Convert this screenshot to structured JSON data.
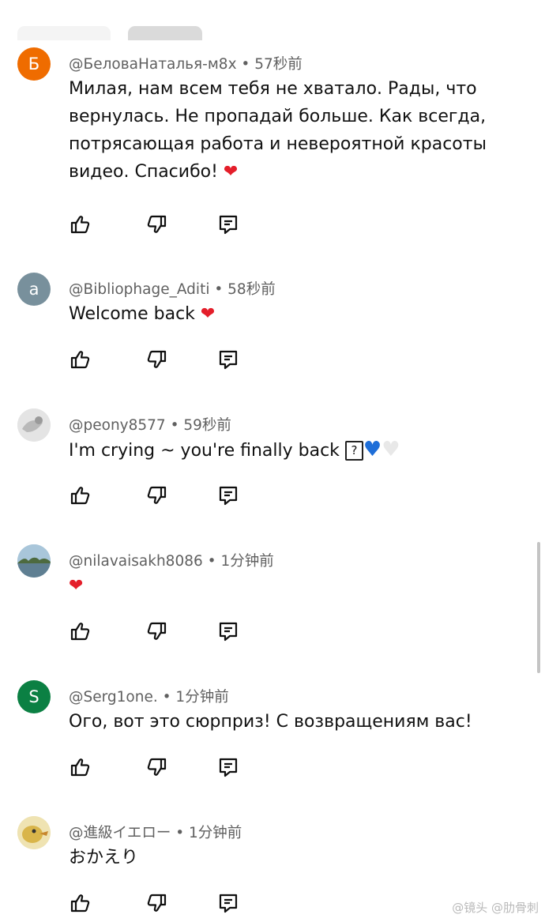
{
  "comments": [
    {
      "avatar_letter": "Б",
      "avatar_color": "#ef6c00",
      "author": "@БеловаНаталья-м8х",
      "separator": " • ",
      "time": "57秒前",
      "text": "Милая, нам всем тебя не хватало. Рады, что вернулась. Не пропадай больше. Как всегда, потрясающая работа и невероятной красоты видео. Спасибо! ",
      "emoji": "❤"
    },
    {
      "avatar_letter": "a",
      "avatar_color": "#78909c",
      "author": "@Bibliophage_Aditi",
      "separator": " • ",
      "time": "58秒前",
      "text": "Welcome back ",
      "emoji": "❤"
    },
    {
      "avatar_letter": "",
      "avatar_color": "#dcdcdc",
      "author": "@peony8577",
      "separator": " • ",
      "time": "59秒前",
      "text": "I'm crying ~ you're finally back ",
      "box_glyph": "?",
      "emoji_blue": "♥",
      "emoji_white": "♥"
    },
    {
      "avatar_letter": "",
      "avatar_color": "#8fb3c9",
      "author": "@nilavaisakh8086",
      "separator": " • ",
      "time": "1分钟前",
      "text": "",
      "emoji": "❤"
    },
    {
      "avatar_letter": "S",
      "avatar_color": "#0b8043",
      "author": "@Serg1one.",
      "separator": " • ",
      "time": "1分钟前",
      "text": "Ого, вот это сюрприз! С возвращениям вас!"
    },
    {
      "avatar_letter": "",
      "avatar_color": "#e6d9a8",
      "author": "@進級イエロー",
      "separator": " • ",
      "time": "1分钟前",
      "text": "おかえり"
    }
  ],
  "icons": {
    "like": "thumb-up-icon",
    "dislike": "thumb-down-icon",
    "reply": "reply-icon"
  },
  "watermark": "@镜头 @肋骨刺"
}
